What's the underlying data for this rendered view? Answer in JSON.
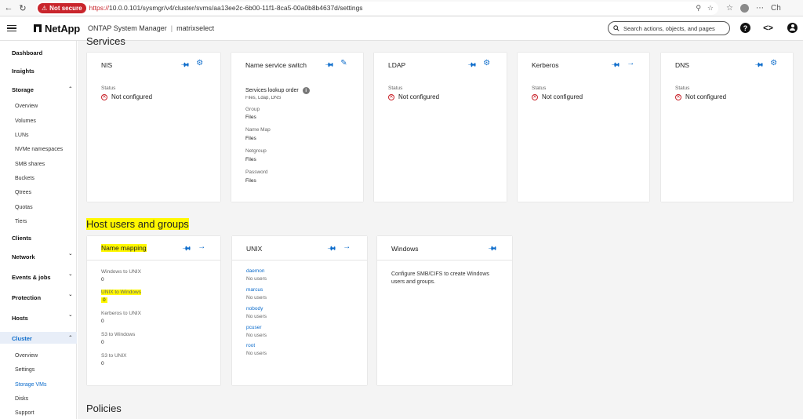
{
  "browser": {
    "insecure_label": "Not secure",
    "url_scheme": "https://",
    "url_rest": "10.0.0.101/sysmgr/v4/cluster/svms/aa13ee2c-6b00-11f1-8ca5-00a0b8b4637d/settings",
    "ext_label": "Ch"
  },
  "header": {
    "logo": "NetApp",
    "app_title": "ONTAP System Manager",
    "separator": "|",
    "cluster": "matrixselect",
    "search_placeholder": "Search actions, objects, and pages"
  },
  "sidebar": {
    "dashboard": "Dashboard",
    "insights": "Insights",
    "storage": "Storage",
    "storage_items": [
      "Overview",
      "Volumes",
      "LUNs",
      "NVMe namespaces",
      "SMB shares",
      "Buckets",
      "Qtrees",
      "Quotas",
      "Tiers"
    ],
    "clients": "Clients",
    "network": "Network",
    "events": "Events & jobs",
    "protection": "Protection",
    "hosts": "Hosts",
    "cluster": "Cluster",
    "cluster_items": [
      "Overview",
      "Settings",
      "Storage VMs",
      "Disks",
      "Support"
    ]
  },
  "sections": {
    "services": "Services",
    "host_users": "Host users and groups",
    "policies": "Policies"
  },
  "services": {
    "nis": {
      "title": "NIS",
      "status_label": "Status",
      "status": "Not configured"
    },
    "nss": {
      "title": "Name service switch",
      "lookup_label": "Services lookup order",
      "lookup_value": "Files, Ldap, DNS",
      "group_label": "Group",
      "group_value": "Files",
      "namemap_label": "Name Map",
      "namemap_value": "Files",
      "netgroup_label": "Netgroup",
      "netgroup_value": "Files",
      "password_label": "Password",
      "password_value": "Files"
    },
    "ldap": {
      "title": "LDAP",
      "status_label": "Status",
      "status": "Not configured"
    },
    "kerberos": {
      "title": "Kerberos",
      "status_label": "Status",
      "status": "Not configured"
    },
    "dns": {
      "title": "DNS",
      "status_label": "Status",
      "status": "Not configured"
    }
  },
  "host_cards": {
    "name_mapping": {
      "title": "Name mapping",
      "rows": [
        {
          "label": "Windows to UNIX",
          "value": "0"
        },
        {
          "label": "UNIX to Windows",
          "value": "0"
        },
        {
          "label": "Kerberos to UNIX",
          "value": "0"
        },
        {
          "label": "S3 to Windows",
          "value": "0"
        },
        {
          "label": "S3 to UNIX",
          "value": "0"
        }
      ]
    },
    "unix": {
      "title": "UNIX",
      "users": [
        {
          "name": "daemon",
          "info": "No users"
        },
        {
          "name": "marcus",
          "info": "No users"
        },
        {
          "name": "nobody",
          "info": "No users"
        },
        {
          "name": "pcuser",
          "info": "No users"
        },
        {
          "name": "root",
          "info": "No users"
        }
      ]
    },
    "windows": {
      "title": "Windows",
      "description": "Configure SMB/CIFS to create Windows users and groups."
    }
  },
  "colors": {
    "accent": "#0b6bcb",
    "error": "#c9252c",
    "highlight": "#fff800"
  }
}
